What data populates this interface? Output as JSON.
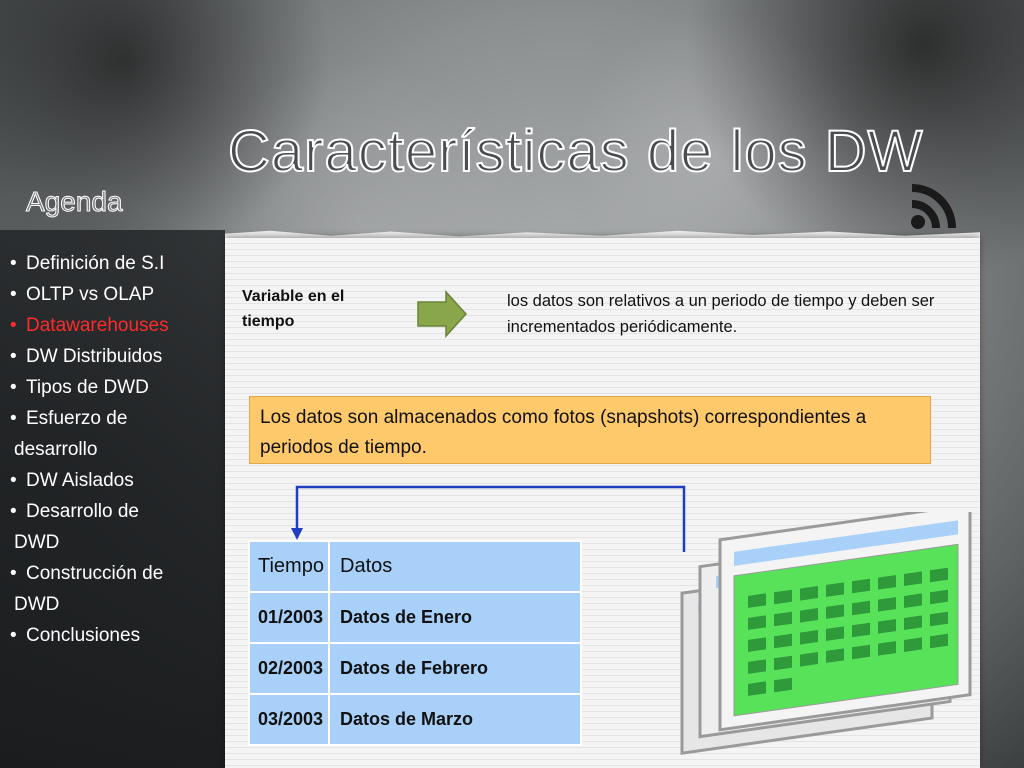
{
  "slide": {
    "title": "Características de los DW",
    "agenda_title": "Agenda",
    "agenda_items": [
      {
        "line1": "Definición de S.I",
        "line2": ""
      },
      {
        "line1": "OLTP vs OLAP",
        "line2": ""
      },
      {
        "line1": "Datawarehouses",
        "line2": "",
        "active": true
      },
      {
        "line1": "DW Distribuidos",
        "line2": ""
      },
      {
        "line1": "Tipos de DWD",
        "line2": ""
      },
      {
        "line1": "Esfuerzo de",
        "line2": "desarrollo"
      },
      {
        "line1": "DW Aislados",
        "line2": ""
      },
      {
        "line1": "Desarrollo de",
        "line2": "DWD"
      },
      {
        "line1": "Construcción de",
        "line2": "DWD"
      },
      {
        "line1": "Conclusiones",
        "line2": ""
      }
    ],
    "variable_label": "Variable en el tiempo",
    "description": "los datos son relativos a un periodo de tiempo y deben ser incrementados periódicamente.",
    "snapshot_text": "Los datos son almacenados como fotos (snapshots) correspondientes a periodos de tiempo.",
    "table": {
      "headers": [
        "Tiempo",
        "Datos"
      ],
      "rows": [
        [
          "01/2003",
          "Datos de Enero"
        ],
        [
          "02/2003",
          "Datos de Febrero"
        ],
        [
          "03/2003",
          "Datos de Marzo"
        ]
      ]
    },
    "colors": {
      "active_item": "#ff2a2a",
      "snapshot_bg": "#fdc96a",
      "table_cell": "#a8d0f8",
      "arrow": "#8aa64a",
      "connector": "#1f3fbf",
      "screen_green": "#57e25a"
    },
    "icons": [
      "rss-icon",
      "right-arrow-icon",
      "snapshot-screens-icon"
    ]
  }
}
